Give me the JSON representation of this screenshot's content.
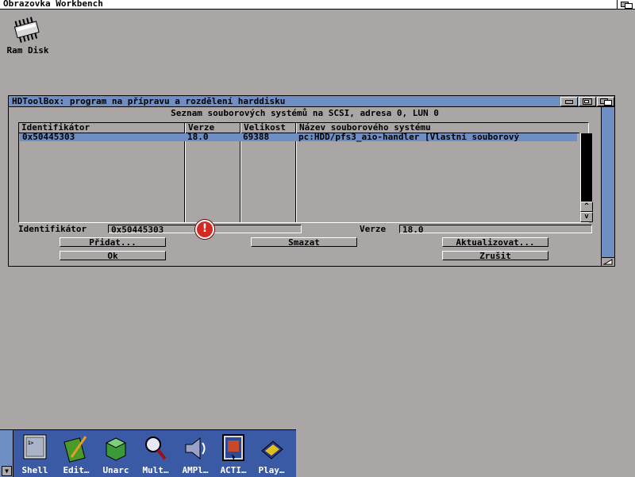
{
  "screen": {
    "title": "Obrazovka Workbench"
  },
  "desktop": {
    "icons": [
      {
        "label": "Ram Disk",
        "icon": "ram-disk-chip-icon"
      }
    ]
  },
  "window": {
    "title": "HDToolBox: program na přípravu a rozdělení harddisku",
    "subtitle": "Seznam souborových systémů na SCSI, adresa 0, LUN 0",
    "list": {
      "columns": [
        "Identifikátor",
        "Verze",
        "Velikost",
        "Název souborového systému"
      ],
      "rows": [
        {
          "id": "0x50445303",
          "version": "18.0",
          "size": "69388",
          "name": "pc:HDD/pfs3_aio-handler [Vlastní souborový"
        }
      ],
      "scroll_up": "^",
      "scroll_down": "v"
    },
    "form": {
      "id_label": "Identifikátor",
      "id_value": "0x50445303",
      "version_label": "Verze",
      "version_value": "18.0"
    },
    "buttons": {
      "add": "Přidat...",
      "delete": "Smazat",
      "update": "Aktualizovat...",
      "ok": "Ok",
      "cancel": "Zrušit"
    },
    "warning_glyph": "!"
  },
  "dock": {
    "items": [
      {
        "label": "Shell",
        "icon": "shell-icon"
      },
      {
        "label": "Edit…",
        "icon": "edit-icon"
      },
      {
        "label": "Unarc",
        "icon": "unarc-icon"
      },
      {
        "label": "Mult…",
        "icon": "multiview-icon"
      },
      {
        "label": "AMPl…",
        "icon": "amplifier-icon"
      },
      {
        "label": "ACTI…",
        "icon": "activity-icon"
      },
      {
        "label": "Play…",
        "icon": "play-icon"
      }
    ]
  },
  "colors": {
    "background": "#aaa6a6",
    "accent": "#6f8fc4",
    "dock": "#3a5aa6",
    "warning": "#d42a22"
  }
}
